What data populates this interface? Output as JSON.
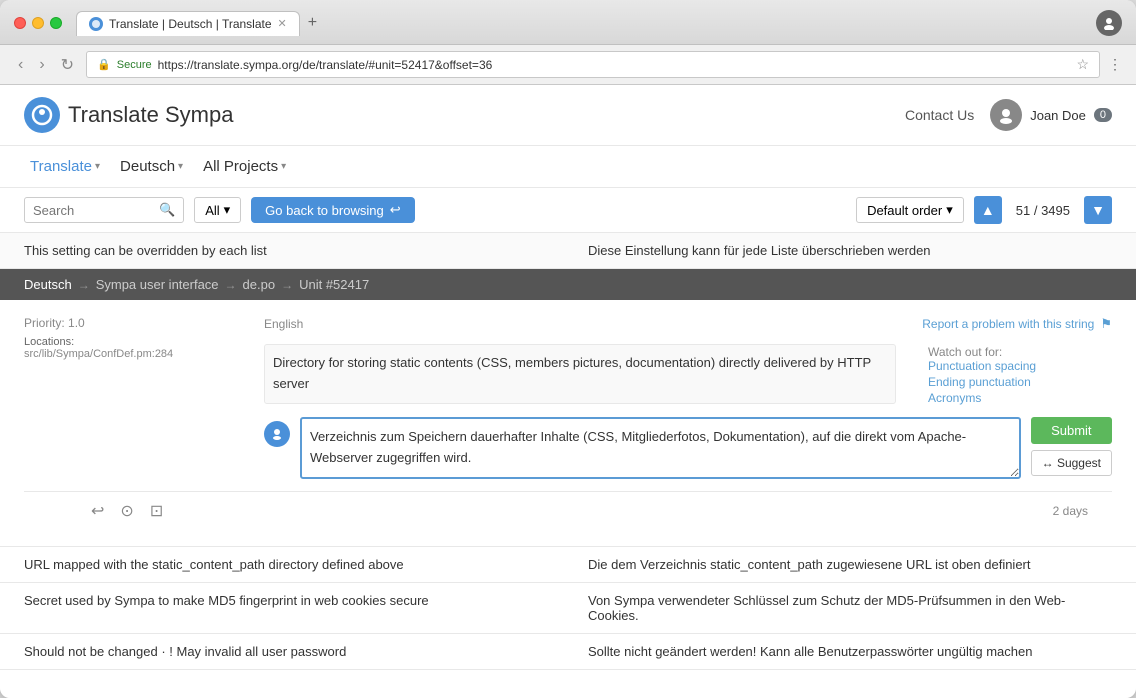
{
  "browser": {
    "tab_title": "Translate | Deutsch | Translate",
    "url": "https://translate.sympa.org/de/translate/#unit=52417&offset=36",
    "secure_label": "Secure"
  },
  "header": {
    "logo_text": "Translate Sympa",
    "contact_label": "Contact Us",
    "user_name": "Joan Doe",
    "notification_count": "0"
  },
  "nav": {
    "translate_label": "Translate",
    "deutsch_label": "Deutsch",
    "all_projects_label": "All Projects"
  },
  "toolbar": {
    "search_placeholder": "Search",
    "filter_label": "All",
    "go_back_label": "Go back to browsing",
    "order_label": "Default order",
    "unit_current": "51",
    "unit_total": "3495"
  },
  "context": {
    "source": "This setting can be overridden by each list",
    "target": "Diese Einstellung kann für jede Liste überschrieben werden"
  },
  "breadcrumb": {
    "lang": "Deutsch",
    "project": "Sympa user interface",
    "file": "de.po",
    "unit": "Unit #52417"
  },
  "unit": {
    "priority_label": "Priority:",
    "priority_value": "1.0",
    "location_label": "Locations:",
    "location_path": "src/lib/Sympa/ConfDef.pm:284",
    "lang_label": "English",
    "report_label": "Report a problem with this string",
    "watch_label": "Watch out for:",
    "watch_items": [
      "Punctuation spacing",
      "Ending punctuation",
      "Acronyms"
    ],
    "source_text": "Directory for storing static contents (CSS, members pictures, documentation) directly delivered by HTTP server",
    "target_text": "Verzeichnis zum Speichern dauerhafter Inhalte (CSS, Mitgliederfotos, Dokumentation), auf die direkt vom Apache-Webserver zugegriffen wird.",
    "submit_label": "Submit",
    "suggest_label": "↔ Suggest",
    "time_ago": "2 days"
  },
  "other_units": [
    {
      "source": "URL mapped with the static_content_path directory defined above",
      "target": "Die dem Verzeichnis static_content_path zugewiesene URL ist oben definiert"
    },
    {
      "source": "Secret used by Sympa to make MD5 fingerprint in web cookies secure",
      "target": "Von Sympa verwendeter Schlüssel zum Schutz der MD5-Prüfsummen in den Web-Cookies."
    },
    {
      "source": "Should not be changed · ! May invalid all user password",
      "target": "Sollte nicht geändert werden! Kann alle Benutzerpasswörter ungültig machen"
    }
  ]
}
